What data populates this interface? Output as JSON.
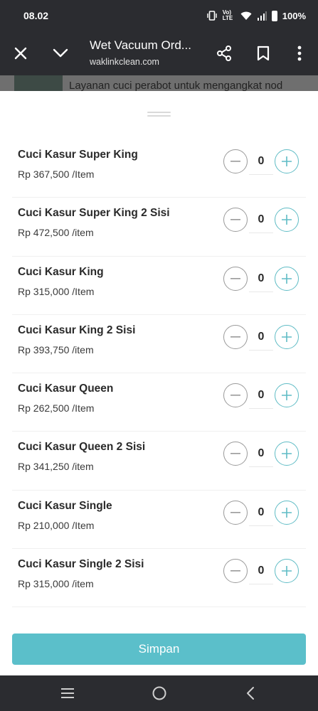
{
  "status_bar": {
    "time": "08.02",
    "network_label": "Vo) LTE",
    "battery": "100%"
  },
  "toolbar": {
    "title": "Wet Vacuum Ord...",
    "url": "waklinkclean.com"
  },
  "backdrop": {
    "text": "Layanan cuci perabot untuk mengangkat nod"
  },
  "items": [
    {
      "name": "Cuci Kasur Super King",
      "price": "Rp 367,500 /Item",
      "qty": "0"
    },
    {
      "name": "Cuci Kasur Super King 2 Sisi",
      "price": "Rp 472,500 /item",
      "qty": "0"
    },
    {
      "name": "Cuci Kasur King",
      "price": "Rp 315,000 /Item",
      "qty": "0"
    },
    {
      "name": "Cuci Kasur King 2 Sisi",
      "price": "Rp 393,750 /item",
      "qty": "0"
    },
    {
      "name": "Cuci Kasur Queen",
      "price": "Rp 262,500 /Item",
      "qty": "0"
    },
    {
      "name": "Cuci Kasur Queen 2 Sisi",
      "price": "Rp 341,250 /item",
      "qty": "0"
    },
    {
      "name": "Cuci Kasur Single",
      "price": "Rp 210,000 /Item",
      "qty": "0"
    },
    {
      "name": "Cuci Kasur Single 2 Sisi",
      "price": "Rp 315,000 /item",
      "qty": "0"
    }
  ],
  "save_label": "Simpan",
  "colors": {
    "accent": "#5bbfca",
    "chrome": "#2b2c30",
    "minus_border": "#9a9a9a"
  },
  "icons": {
    "close": "close-icon",
    "collapse": "chevron-down-icon",
    "share": "share-icon",
    "bookmark": "bookmark-icon",
    "more": "more-vertical-icon",
    "minus": "minus-icon",
    "plus": "plus-icon",
    "nav_recents": "recents-icon",
    "nav_home": "home-icon",
    "nav_back": "back-icon"
  }
}
